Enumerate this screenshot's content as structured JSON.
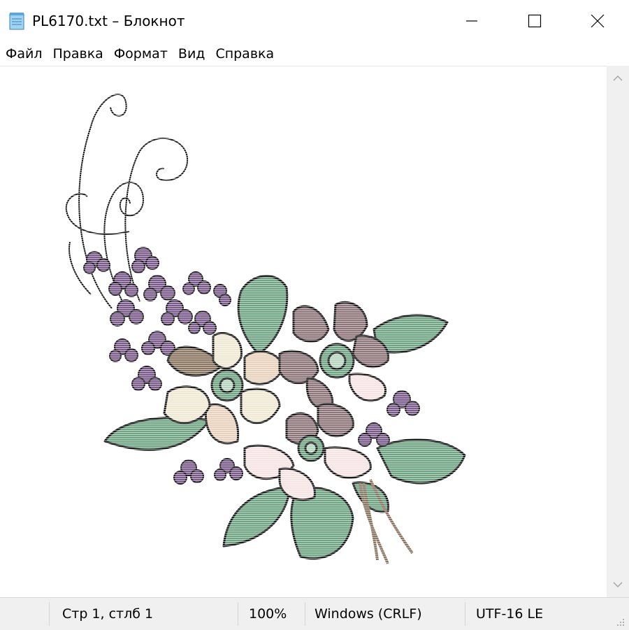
{
  "window": {
    "title": "PL6170.txt – Блокнот",
    "app_icon": "notepad-icon",
    "controls": {
      "minimize": "minimize-icon",
      "maximize": "maximize-icon",
      "close": "close-icon"
    }
  },
  "menu": {
    "items": [
      "Файл",
      "Правка",
      "Формат",
      "Вид",
      "Справка"
    ]
  },
  "editor": {
    "content_art": "floral-ascii-art",
    "colors": {
      "leaf": "#6fa482",
      "violet": "#7a5a8a",
      "mauve": "#8c7478",
      "cream": "#efe9d4",
      "pink": "#f6e3e3",
      "peach": "#e8d2bd",
      "taupe": "#8a7560",
      "stroke": "#1a1a1a"
    }
  },
  "status": {
    "position": "Стр 1, стлб 1",
    "zoom": "100%",
    "line_endings": "Windows (CRLF)",
    "encoding": "UTF-16 LE"
  }
}
